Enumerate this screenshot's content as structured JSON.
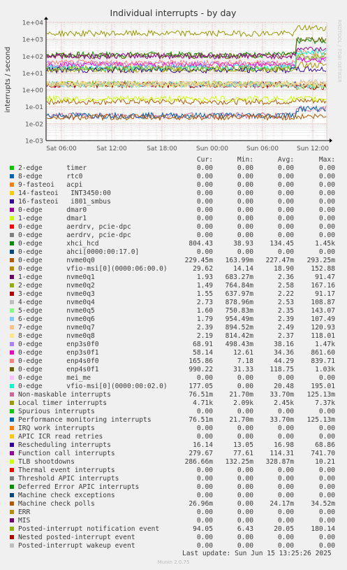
{
  "chart_data": {
    "type": "line",
    "title": "Individual interrupts - by day",
    "ylabel": "interrupts / second",
    "yscale": "log",
    "ylim": [
      0.001,
      10000
    ],
    "ytick_labels": [
      "1e-03",
      "1e-02",
      "1e-01",
      "1e+00",
      "1e+01",
      "1e+02",
      "1e+03",
      "1e+04"
    ],
    "xtick_labels": [
      "Sat 06:00",
      "Sat 12:00",
      "Sat 18:00",
      "Sun 00:00",
      "Sun 06:00",
      "Sun 12:00"
    ],
    "grid": true,
    "watermark": "RRDTOOL / TOBI OETIKER",
    "columns": [
      "Cur:",
      "Min:",
      "Avg:",
      "Max:"
    ],
    "series": [
      {
        "name": "2-edge      timer",
        "color": "#00cc00",
        "cur": "0.00",
        "min": "0.00",
        "avg": "0.00",
        "max": "0.00"
      },
      {
        "name": "8-edge      rtc0",
        "color": "#0066b3",
        "cur": "0.00",
        "min": "0.00",
        "avg": "0.00",
        "max": "0.00"
      },
      {
        "name": "9-fasteoi   acpi",
        "color": "#ff8000",
        "cur": "0.00",
        "min": "0.00",
        "avg": "0.00",
        "max": "0.00"
      },
      {
        "name": "14-fasteoi   INT3450:00",
        "color": "#ffcc00",
        "cur": "0.00",
        "min": "0.00",
        "avg": "0.00",
        "max": "0.00"
      },
      {
        "name": "16-fasteoi   i801_smbus",
        "color": "#330099",
        "cur": "0.00",
        "min": "0.00",
        "avg": "0.00",
        "max": "0.00"
      },
      {
        "name": "0-edge      dmar0",
        "color": "#990099",
        "cur": "0.00",
        "min": "0.00",
        "avg": "0.00",
        "max": "0.00"
      },
      {
        "name": "1-edge      dmar1",
        "color": "#ccff00",
        "cur": "0.00",
        "min": "0.00",
        "avg": "0.00",
        "max": "0.00"
      },
      {
        "name": "0-edge      aerdrv, pcie-dpc",
        "color": "#ff0000",
        "cur": "0.00",
        "min": "0.00",
        "avg": "0.00",
        "max": "0.00"
      },
      {
        "name": "0-edge      aerdrv, pcie-dpc",
        "color": "#808080",
        "cur": "0.00",
        "min": "0.00",
        "avg": "0.00",
        "max": "0.00"
      },
      {
        "name": "0-edge      xhci_hcd",
        "color": "#008f00",
        "cur": "804.43",
        "min": "38.93",
        "avg": "134.45",
        "max": "1.45k"
      },
      {
        "name": "0-edge      ahci[0000:00:17.0]",
        "color": "#00487d",
        "cur": "0.00",
        "min": "0.00",
        "avg": "0.00",
        "max": "0.00"
      },
      {
        "name": "0-edge      nvme0q0",
        "color": "#b35a00",
        "cur": "229.45m",
        "min": "163.99m",
        "avg": "227.47m",
        "max": "293.25m"
      },
      {
        "name": "0-edge      vfio-msi[0](0000:06:00.0)",
        "color": "#b38f00",
        "cur": "29.62",
        "min": "14.14",
        "avg": "18.90",
        "max": "152.88"
      },
      {
        "name": "1-edge      nvme0q1",
        "color": "#6b006b",
        "cur": "1.93",
        "min": "683.27m",
        "avg": "2.36",
        "max": "91.47"
      },
      {
        "name": "2-edge      nvme0q2",
        "color": "#8fb300",
        "cur": "1.49",
        "min": "764.84m",
        "avg": "2.58",
        "max": "167.16"
      },
      {
        "name": "3-edge      nvme0q3",
        "color": "#b30000",
        "cur": "1.55",
        "min": "637.97m",
        "avg": "2.22",
        "max": "91.17"
      },
      {
        "name": "4-edge      nvme0q4",
        "color": "#bebebe",
        "cur": "2.73",
        "min": "878.96m",
        "avg": "2.53",
        "max": "108.87"
      },
      {
        "name": "5-edge      nvme0q5",
        "color": "#80ff80",
        "cur": "1.60",
        "min": "750.83m",
        "avg": "2.35",
        "max": "143.07"
      },
      {
        "name": "6-edge      nvme0q6",
        "color": "#80c9ff",
        "cur": "1.79",
        "min": "954.49m",
        "avg": "2.39",
        "max": "107.49"
      },
      {
        "name": "7-edge      nvme0q7",
        "color": "#ffc080",
        "cur": "2.39",
        "min": "894.52m",
        "avg": "2.49",
        "max": "120.93"
      },
      {
        "name": "8-edge      nvme0q8",
        "color": "#ffe680",
        "cur": "2.19",
        "min": "814.42m",
        "avg": "2.37",
        "max": "118.01"
      },
      {
        "name": "0-edge      enp3s0f0",
        "color": "#aa80ff",
        "cur": "68.91",
        "min": "498.43m",
        "avg": "38.16",
        "max": "1.47k"
      },
      {
        "name": "0-edge      enp3s0f1",
        "color": "#ee00cc",
        "cur": "58.14",
        "min": "12.61",
        "avg": "34.36",
        "max": "861.60"
      },
      {
        "name": "0-edge      enp4s0f0",
        "color": "#ff8080",
        "cur": "165.86",
        "min": "7.18",
        "avg": "44.29",
        "max": "839.71"
      },
      {
        "name": "0-edge      enp4s0f1",
        "color": "#666600",
        "cur": "990.22",
        "min": "31.33",
        "avg": "118.75",
        "max": "1.03k"
      },
      {
        "name": "0-edge      mei_me",
        "color": "#ffbfff",
        "cur": "0.00",
        "min": "0.00",
        "avg": "0.00",
        "max": "0.00"
      },
      {
        "name": "0-edge      vfio-msi[0](0000:00:02.0)",
        "color": "#00ffcc",
        "cur": "177.05",
        "min": "0.00",
        "avg": "20.48",
        "max": "195.01"
      },
      {
        "name": "Non-maskable interrupts",
        "color": "#cc6699",
        "cur": "76.51m",
        "min": "21.70m",
        "avg": "33.70m",
        "max": "125.13m"
      },
      {
        "name": "Local timer interrupts",
        "color": "#999900",
        "cur": "4.71k",
        "min": "2.09k",
        "avg": "2.45k",
        "max": "7.37k"
      },
      {
        "name": "Spurious interrupts",
        "color": "#00cc00",
        "cur": "0.00",
        "min": "0.00",
        "avg": "0.00",
        "max": "0.00"
      },
      {
        "name": "Performance monitoring interrupts",
        "color": "#0066b3",
        "cur": "76.51m",
        "min": "21.70m",
        "avg": "33.70m",
        "max": "125.13m"
      },
      {
        "name": "IRQ work interrupts",
        "color": "#ff8000",
        "cur": "0.00",
        "min": "0.00",
        "avg": "0.00",
        "max": "0.00"
      },
      {
        "name": "APIC ICR read retries",
        "color": "#ffcc00",
        "cur": "0.00",
        "min": "0.00",
        "avg": "0.00",
        "max": "0.00"
      },
      {
        "name": "Rescheduling interrupts",
        "color": "#330099",
        "cur": "16.14",
        "min": "13.05",
        "avg": "16.98",
        "max": "68.86"
      },
      {
        "name": "Function call interrupts",
        "color": "#990099",
        "cur": "279.67",
        "min": "77.61",
        "avg": "114.31",
        "max": "741.70"
      },
      {
        "name": "TLB shootdowns",
        "color": "#ccff00",
        "cur": "286.66m",
        "min": "132.25m",
        "avg": "328.87m",
        "max": "10.21"
      },
      {
        "name": "Thermal event interrupts",
        "color": "#ff0000",
        "cur": "0.00",
        "min": "0.00",
        "avg": "0.00",
        "max": "0.00"
      },
      {
        "name": "Threshold APIC interrupts",
        "color": "#808080",
        "cur": "0.00",
        "min": "0.00",
        "avg": "0.00",
        "max": "0.00"
      },
      {
        "name": "Deferred Error APIC interrupts",
        "color": "#008f00",
        "cur": "0.00",
        "min": "0.00",
        "avg": "0.00",
        "max": "0.00"
      },
      {
        "name": "Machine check exceptions",
        "color": "#00487d",
        "cur": "0.00",
        "min": "0.00",
        "avg": "0.00",
        "max": "0.00"
      },
      {
        "name": "Machine check polls",
        "color": "#b35a00",
        "cur": "26.96m",
        "min": "0.00",
        "avg": "24.17m",
        "max": "34.52m"
      },
      {
        "name": "ERR",
        "color": "#b38f00",
        "cur": "0.00",
        "min": "0.00",
        "avg": "0.00",
        "max": "0.00"
      },
      {
        "name": "MIS",
        "color": "#6b006b",
        "cur": "0.00",
        "min": "0.00",
        "avg": "0.00",
        "max": "0.00"
      },
      {
        "name": "Posted-interrupt notification event",
        "color": "#8fb300",
        "cur": "94.05",
        "min": "6.43",
        "avg": "20.05",
        "max": "180.14"
      },
      {
        "name": "Nested posted-interrupt event",
        "color": "#b30000",
        "cur": "0.00",
        "min": "0.00",
        "avg": "0.00",
        "max": "0.00"
      },
      {
        "name": "Posted-interrupt wakeup event",
        "color": "#bebebe",
        "cur": "0.00",
        "min": "0.00",
        "avg": "0.00",
        "max": "0.00"
      }
    ]
  },
  "footer": {
    "last_update": "Last update: Sun Jun 15 13:25:26 2025",
    "version": "Munin 2.0.75"
  }
}
